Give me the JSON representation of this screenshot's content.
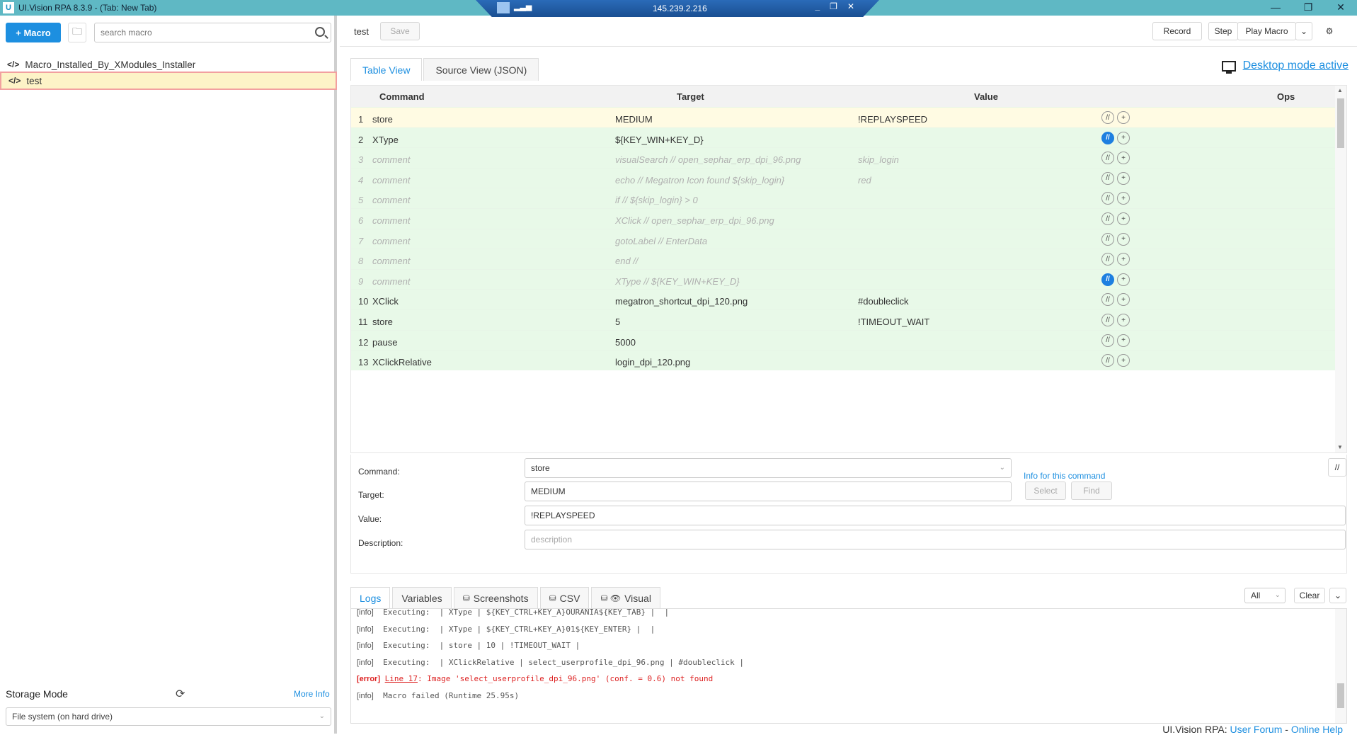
{
  "window": {
    "logo": "U",
    "title": "UI.Vision RPA 8.3.9 - (Tab: New Tab)",
    "rdp_ip": "145.239.2.216"
  },
  "sidebar": {
    "new_macro_label": "+ Macro",
    "search_placeholder": "search macro",
    "macros": [
      {
        "name": "Macro_Installed_By_XModules_Installer",
        "selected": false
      },
      {
        "name": "test",
        "selected": true
      }
    ],
    "storage_mode_label": "Storage Mode",
    "more_info_label": "More Info",
    "storage_value": "File system (on hard drive)"
  },
  "toolbar": {
    "macro_name": "test",
    "save_label": "Save",
    "record_label": "Record",
    "step_label": "Step",
    "play_label": "Play Macro"
  },
  "editor": {
    "tabs": [
      "Table View",
      "Source View (JSON)"
    ],
    "desktop_mode_label": "Desktop mode active",
    "columns": {
      "command": "Command",
      "target": "Target",
      "value": "Value",
      "ops": "Ops"
    },
    "rows": [
      {
        "num": "1",
        "command": "store",
        "target": "MEDIUM",
        "value": "!REPLAYSPEED",
        "state": "yellow",
        "comment": false,
        "ops_active": false
      },
      {
        "num": "2",
        "command": "XType",
        "target": "${KEY_WIN+KEY_D}",
        "value": "",
        "state": "green",
        "comment": false,
        "ops_active": true
      },
      {
        "num": "3",
        "command": "comment",
        "target": "visualSearch // open_sephar_erp_dpi_96.png",
        "value": "skip_login",
        "state": "green",
        "comment": true,
        "ops_active": false
      },
      {
        "num": "4",
        "command": "comment",
        "target": "echo // Megatron Icon found ${skip_login}",
        "value": "red",
        "state": "green",
        "comment": true,
        "ops_active": false
      },
      {
        "num": "5",
        "command": "comment",
        "target": "if // ${skip_login} > 0",
        "value": "",
        "state": "green",
        "comment": true,
        "ops_active": false
      },
      {
        "num": "6",
        "command": "comment",
        "target": "XClick // open_sephar_erp_dpi_96.png",
        "value": "",
        "state": "green",
        "comment": true,
        "ops_active": false
      },
      {
        "num": "7",
        "command": "comment",
        "target": "gotoLabel // EnterData",
        "value": "",
        "state": "green",
        "comment": true,
        "ops_active": false
      },
      {
        "num": "8",
        "command": "comment",
        "target": "end //",
        "value": "",
        "state": "green",
        "comment": true,
        "ops_active": false
      },
      {
        "num": "9",
        "command": "comment",
        "target": "XType // ${KEY_WIN+KEY_D}",
        "value": "",
        "state": "green",
        "comment": true,
        "ops_active": true
      },
      {
        "num": "10",
        "command": "XClick",
        "target": "megatron_shortcut_dpi_120.png",
        "value": "#doubleclick",
        "state": "green",
        "comment": false,
        "ops_active": false
      },
      {
        "num": "11",
        "command": "store",
        "target": "5",
        "value": "!TIMEOUT_WAIT",
        "state": "green",
        "comment": false,
        "ops_active": false
      },
      {
        "num": "12",
        "command": "pause",
        "target": "5000",
        "value": "",
        "state": "green",
        "comment": false,
        "ops_active": false
      },
      {
        "num": "13",
        "command": "XClickRelative",
        "target": "login_dpi_120.png",
        "value": "",
        "state": "green",
        "comment": false,
        "ops_active": false
      }
    ],
    "form": {
      "command_label": "Command:",
      "command_value": "store",
      "info_link": "Info for this command",
      "target_label": "Target:",
      "target_value": "MEDIUM",
      "select_label": "Select",
      "find_label": "Find",
      "value_label": "Value:",
      "value_value": "!REPLAYSPEED",
      "description_label": "Description:",
      "description_placeholder": "description"
    }
  },
  "logs": {
    "tabs": [
      "Logs",
      "Variables",
      "Screenshots",
      "CSV",
      "Visual"
    ],
    "filter": "All",
    "clear_label": "Clear",
    "lines": [
      {
        "level": "[info]",
        "text": "Executing:  | XType | ${KEY_CTRL+KEY_A}OURANIA${KEY_TAB} |  |",
        "error": false
      },
      {
        "level": "[info]",
        "text": "Executing:  | XType | ${KEY_CTRL+KEY_A}01${KEY_ENTER} |  |",
        "error": false
      },
      {
        "level": "[info]",
        "text": "Executing:  | store | 10 | !TIMEOUT_WAIT |",
        "error": false
      },
      {
        "level": "[info]",
        "text": "Executing:  | XClickRelative | select_userprofile_dpi_96.png | #doubleclick |",
        "error": false
      },
      {
        "level": "[error]",
        "link": "Line 17",
        "text": ": Image 'select_userprofile_dpi_96.png' (conf. = 0.6) not found",
        "error": true
      },
      {
        "level": "[info]",
        "text": "Macro failed (Runtime 25.95s)",
        "error": false
      }
    ]
  },
  "footer": {
    "prefix": "UI.Vision RPA:",
    "forum": "User Forum",
    "sep": "-",
    "help": "Online Help"
  }
}
